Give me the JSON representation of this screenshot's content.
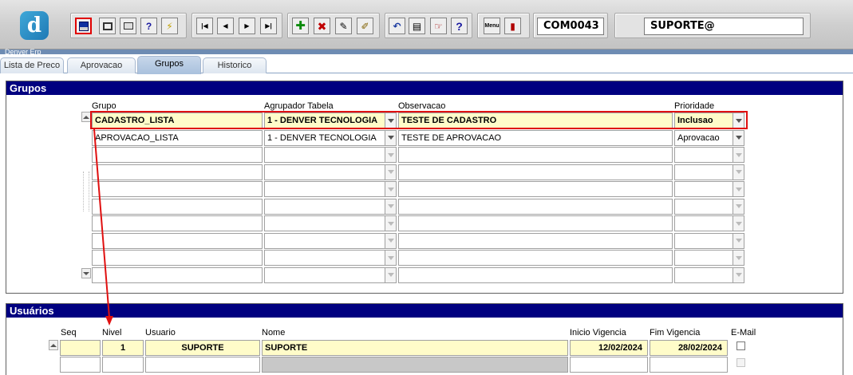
{
  "toolbar": {
    "logo_letter": "d",
    "form_code": "COM0043",
    "user": "SUPORTE@",
    "icons": [
      "save-icon",
      "window-icon",
      "print-icon",
      "query-icon",
      "run-query-icon",
      "first-record-icon",
      "previous-record-icon",
      "next-record-icon",
      "last-record-icon",
      "insert-record-icon",
      "delete-record-icon",
      "edit-icon",
      "clear-icon",
      "undo-icon",
      "clipboard-icon",
      "list-values-icon",
      "help-icon",
      "menu-icon",
      "exit-icon"
    ],
    "menu_label": "Menu"
  },
  "window_title": "Denver Erp",
  "tabs": [
    {
      "label": "Lista de Preco",
      "active": false
    },
    {
      "label": "Aprovacao",
      "active": false
    },
    {
      "label": "Grupos",
      "active": true
    },
    {
      "label": "Historico",
      "active": false
    }
  ],
  "grupos": {
    "title": "Grupos",
    "headers": {
      "grupo": "Grupo",
      "agrupador": "Agrupador Tabela",
      "observacao": "Observacao",
      "prioridade": "Prioridade"
    },
    "rows": [
      {
        "grupo": "CADASTRO_LISTA",
        "agrupador": "1 - DENVER TECNOLOGIA",
        "observacao": "TESTE DE CADASTRO",
        "prioridade": "Inclusao"
      },
      {
        "grupo": "APROVACAO_LISTA",
        "agrupador": "1 - DENVER TECNOLOGIA",
        "observacao": "TESTE DE APROVACAO",
        "prioridade": "Aprovacao"
      },
      {
        "grupo": "",
        "agrupador": "",
        "observacao": "",
        "prioridade": ""
      },
      {
        "grupo": "",
        "agrupador": "",
        "observacao": "",
        "prioridade": ""
      },
      {
        "grupo": "",
        "agrupador": "",
        "observacao": "",
        "prioridade": ""
      },
      {
        "grupo": "",
        "agrupador": "",
        "observacao": "",
        "prioridade": ""
      },
      {
        "grupo": "",
        "agrupador": "",
        "observacao": "",
        "prioridade": ""
      },
      {
        "grupo": "",
        "agrupador": "",
        "observacao": "",
        "prioridade": ""
      },
      {
        "grupo": "",
        "agrupador": "",
        "observacao": "",
        "prioridade": ""
      },
      {
        "grupo": "",
        "agrupador": "",
        "observacao": "",
        "prioridade": ""
      }
    ]
  },
  "usuarios": {
    "title": "Usuários",
    "headers": {
      "seq": "Seq",
      "nivel": "Nivel",
      "usuario": "Usuario",
      "nome": "Nome",
      "inicio": "Inicio Vigencia",
      "fim": "Fim Vigencia",
      "email": "E-Mail"
    },
    "rows": [
      {
        "seq": "",
        "nivel": "1",
        "usuario": "SUPORTE",
        "nome": "SUPORTE",
        "inicio": "12/02/2024",
        "fim": "28/02/2024"
      },
      {
        "seq": "",
        "nivel": "",
        "usuario": "",
        "nome": "",
        "inicio": "",
        "fim": ""
      }
    ]
  },
  "colors": {
    "section_header": "#000080",
    "current_row": "#fffcc9",
    "highlight": "#e01010"
  }
}
